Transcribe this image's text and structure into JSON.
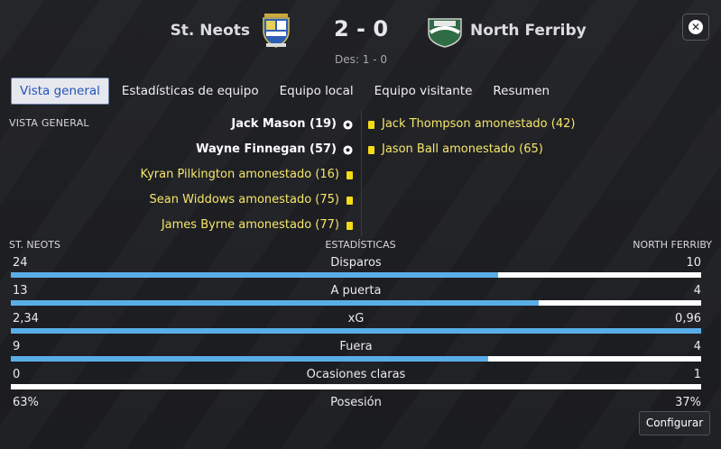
{
  "match": {
    "home_team": "St. Neots",
    "away_team": "North Ferriby",
    "score": "2 - 0",
    "halftime": "Des: 1 - 0"
  },
  "tabs": [
    {
      "label": "Vista general",
      "active": true
    },
    {
      "label": "Estadísticas de equipo",
      "active": false
    },
    {
      "label": "Equipo local",
      "active": false
    },
    {
      "label": "Equipo visitante",
      "active": false
    },
    {
      "label": "Resumen",
      "active": false
    }
  ],
  "overview": {
    "section_label": "VISTA GENERAL",
    "home_events": [
      {
        "type": "goal",
        "text": "Jack Mason (19)"
      },
      {
        "type": "goal",
        "text": "Wayne Finnegan (57)"
      },
      {
        "type": "yellow-card",
        "text": "Kyran Pilkington amonestado (16)"
      },
      {
        "type": "yellow-card",
        "text": "Sean Widdows amonestado (75)"
      },
      {
        "type": "yellow-card",
        "text": "James Byrne amonestado (77)"
      }
    ],
    "away_events": [
      {
        "type": "yellow-card",
        "text": "Jack Thompson amonestado (42)"
      },
      {
        "type": "yellow-card",
        "text": "Jason Ball amonestado (65)"
      }
    ]
  },
  "stats": {
    "home_header": "ST. NEOTS",
    "title": "ESTADÍSTICAS",
    "away_header": "NORTH FERRIBY",
    "rows": [
      {
        "name": "Disparos",
        "home": "24",
        "away": "10",
        "home_share": 0.706
      },
      {
        "name": "A puerta",
        "home": "13",
        "away": "4",
        "home_share": 0.765
      },
      {
        "name": "xG",
        "home": "2,34",
        "away": "0,96",
        "home_share": 1.0
      },
      {
        "name": "Fuera",
        "home": "9",
        "away": "4",
        "home_share": 0.692
      },
      {
        "name": "Ocasiones claras",
        "home": "0",
        "away": "1",
        "home_share": 0.0
      },
      {
        "name": "Posesión",
        "home": "63%",
        "away": "37%",
        "home_share": 0.63
      }
    ]
  },
  "buttons": {
    "configure": "Configurar"
  },
  "colors": {
    "accent_blue": "#5aaee8",
    "yellow_card": "#f5dc18",
    "card_text": "#f6e66a"
  }
}
